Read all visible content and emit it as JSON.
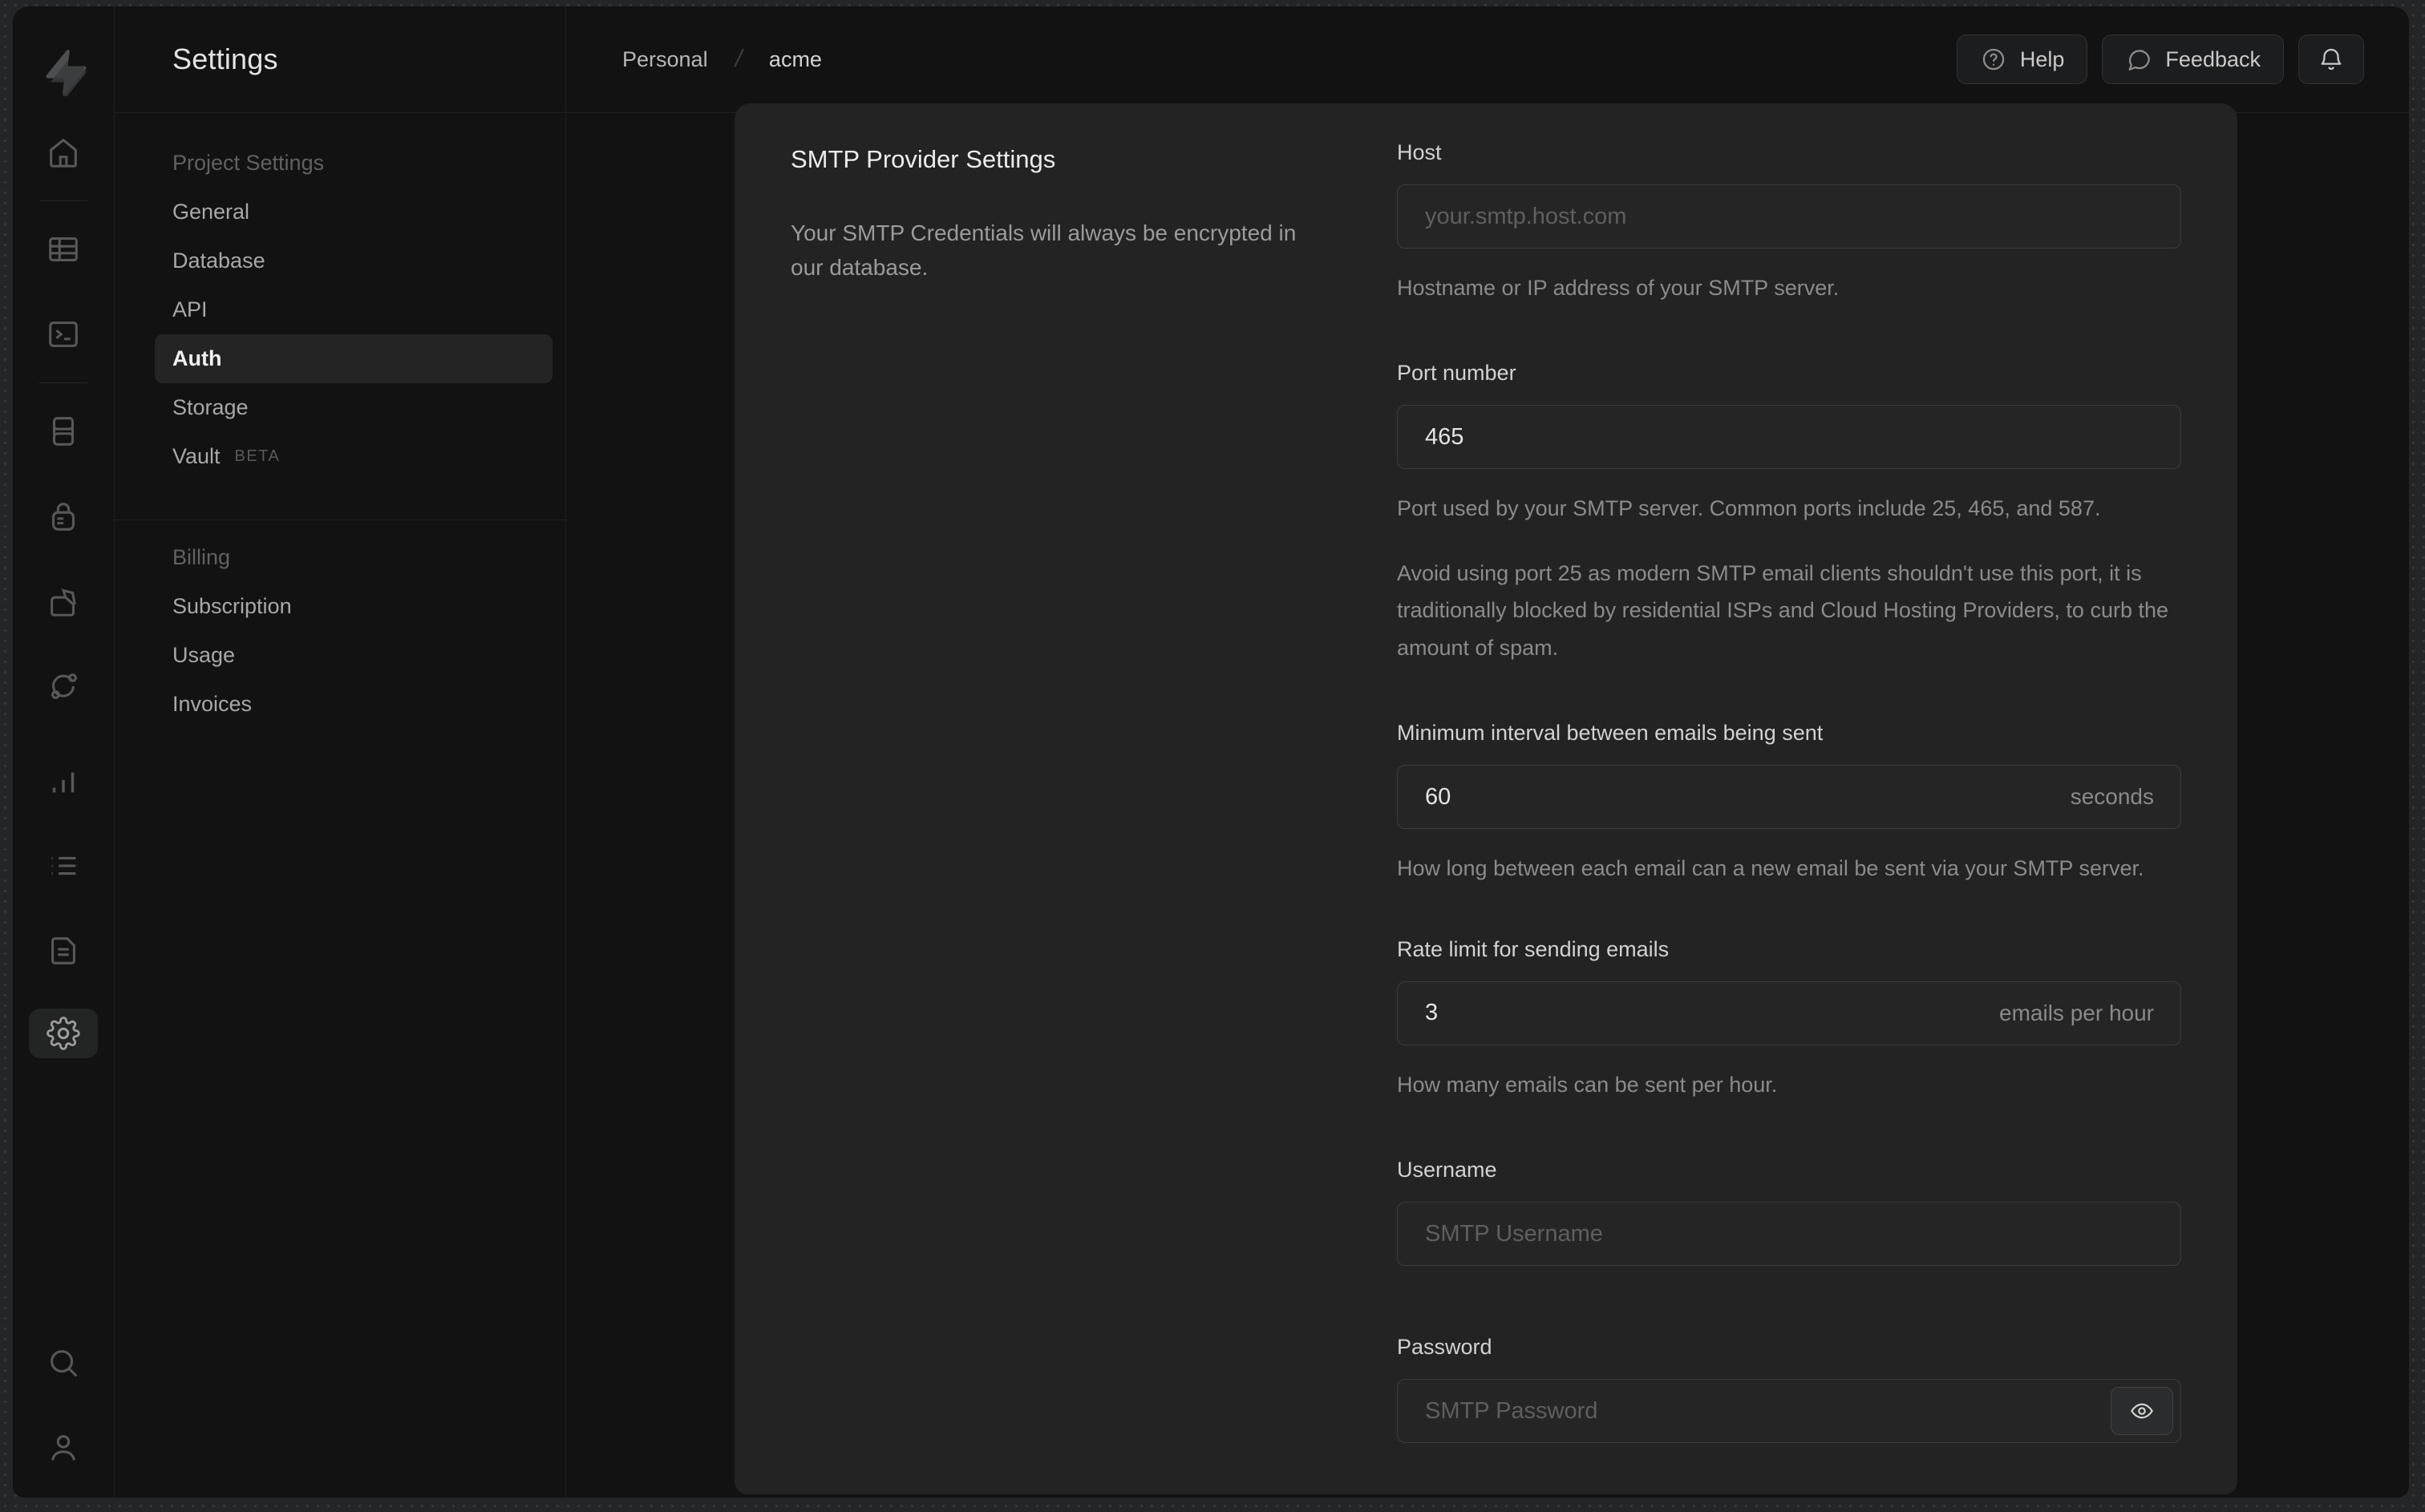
{
  "colors": {
    "frame_bg": "#242526",
    "app_bg": "#121212",
    "panel_bg": "#232324",
    "border": "#1e1f20",
    "input_border": "#3a3b3c",
    "text_primary": "#e6e6e6",
    "text_muted": "#8b8b8b",
    "sidebar_active_bg": "#242425"
  },
  "icons": {
    "rail": [
      "supabase-logo",
      "home-icon",
      "table-editor-icon",
      "sql-editor-icon",
      "database-icon",
      "auth-lock-icon",
      "storage-icon",
      "edge-functions-icon",
      "reports-icon",
      "logs-icon",
      "docs-icon",
      "settings-gear-icon",
      "search-icon",
      "account-icon"
    ],
    "header": [
      "help-icon",
      "feedback-icon",
      "bell-icon"
    ],
    "password_field": "eye-icon"
  },
  "sidebar": {
    "title": "Settings",
    "sections": [
      {
        "header": "Project Settings",
        "items": [
          {
            "label": "General"
          },
          {
            "label": "Database"
          },
          {
            "label": "API"
          },
          {
            "label": "Auth",
            "active": true
          },
          {
            "label": "Storage"
          },
          {
            "label": "Vault",
            "badge": "BETA"
          }
        ]
      },
      {
        "header": "Billing",
        "items": [
          {
            "label": "Subscription"
          },
          {
            "label": "Usage"
          },
          {
            "label": "Invoices"
          }
        ]
      }
    ]
  },
  "header": {
    "breadcrumb": [
      {
        "label": "Personal"
      },
      {
        "label": "acme"
      }
    ],
    "separator": "/",
    "help_label": "Help",
    "feedback_label": "Feedback"
  },
  "content": {
    "section_title": "SMTP Provider Settings",
    "section_description": "Your SMTP Credentials will always be encrypted in our database.",
    "fields": {
      "host": {
        "label": "Host",
        "placeholder": "your.smtp.host.com",
        "helper": "Hostname or IP address of your SMTP server."
      },
      "port": {
        "label": "Port number",
        "value": "465",
        "helper": "Port used by your SMTP server. Common ports include 25, 465, and 587.",
        "note": "Avoid using port 25 as modern SMTP email clients shouldn't use this port, it is traditionally blocked by residential ISPs and Cloud Hosting Providers, to curb the amount of spam."
      },
      "interval": {
        "label": "Minimum interval between emails being sent",
        "value": "60",
        "suffix": "seconds",
        "helper": "How long between each email can a new email be sent via your SMTP server."
      },
      "rate": {
        "label": "Rate limit for sending emails",
        "value": "3",
        "suffix": "emails per hour",
        "helper": "How many emails can be sent per hour."
      },
      "username": {
        "label": "Username",
        "placeholder": "SMTP Username"
      },
      "password": {
        "label": "Password",
        "placeholder": "SMTP Password"
      }
    }
  }
}
